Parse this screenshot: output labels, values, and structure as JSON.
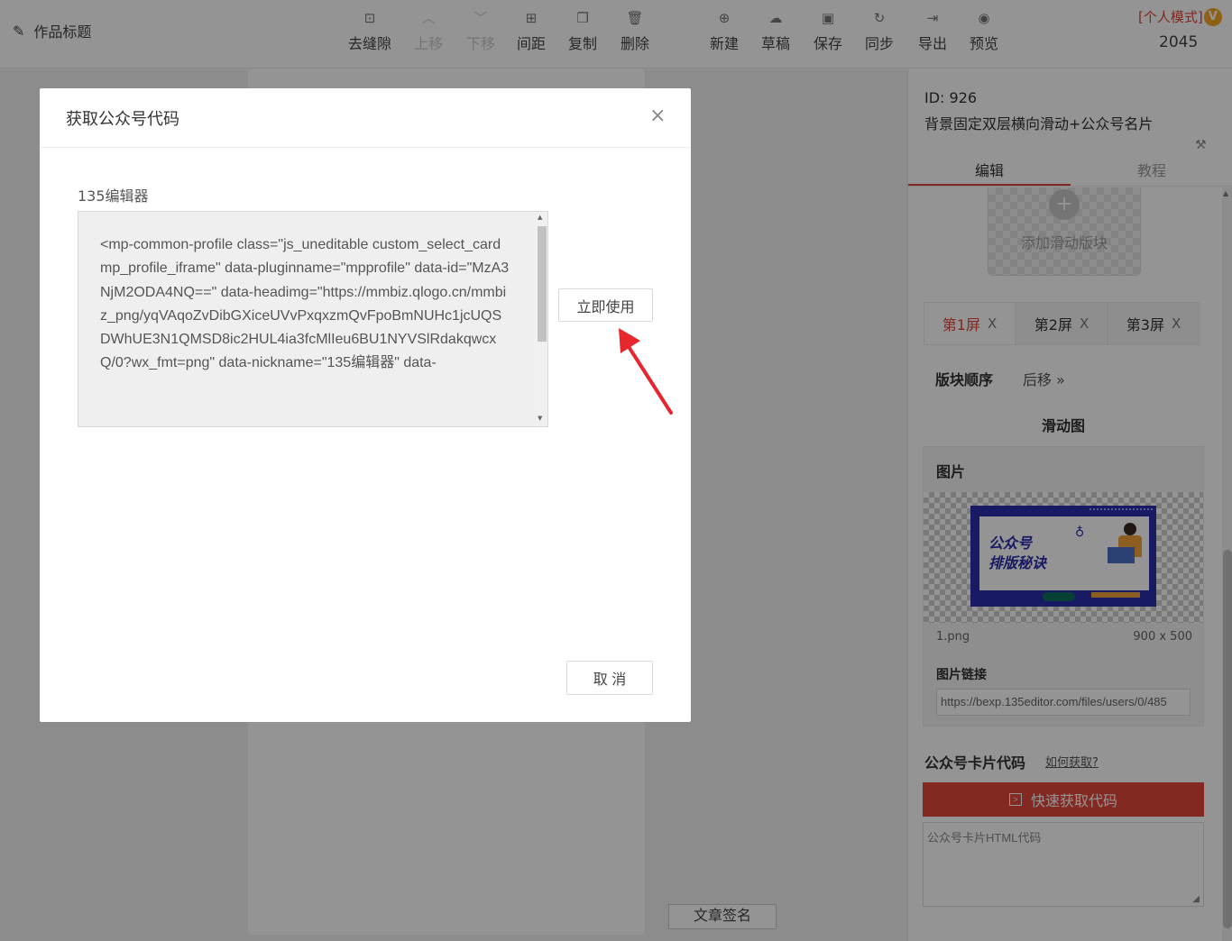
{
  "toolbar": {
    "work_title": "作品标题",
    "tools": [
      {
        "label": "去缝隙",
        "icon": "gap-icon"
      },
      {
        "label": "上移",
        "icon": "chevron-up-icon"
      },
      {
        "label": "下移",
        "icon": "chevron-down-icon"
      },
      {
        "label": "间距",
        "icon": "spacing-icon"
      },
      {
        "label": "复制",
        "icon": "copy-icon"
      },
      {
        "label": "删除",
        "icon": "trash-icon"
      },
      {
        "label": "新建",
        "icon": "new-file-icon"
      },
      {
        "label": "草稿",
        "icon": "cloud-icon"
      },
      {
        "label": "保存",
        "icon": "save-icon"
      },
      {
        "label": "同步",
        "icon": "sync-icon"
      },
      {
        "label": "导出",
        "icon": "export-icon"
      },
      {
        "label": "预览",
        "icon": "eye-icon"
      }
    ],
    "mode_label": "[个人模式]",
    "vip_badge": "V",
    "user_number": "2045"
  },
  "canvas": {
    "signature_button": "文章签名"
  },
  "panel": {
    "template_id": "ID: 926",
    "template_name": "背景固定双层横向滑动+公众号名片",
    "tabs": [
      "编辑",
      "教程"
    ],
    "add_block_label": "添加滑动版块",
    "screens": [
      {
        "label": "第1屏",
        "close": "X"
      },
      {
        "label": "第2屏",
        "close": "X"
      },
      {
        "label": "第3屏",
        "close": "X"
      }
    ],
    "order_label": "版块顺序",
    "move_back_label": "后移 »",
    "slide_title": "滑动图",
    "image": {
      "label": "图片",
      "banner_line1": "公众号",
      "banner_line2": "排版秘诀",
      "file_name": "1.png",
      "file_size": "900 x 500",
      "link_label": "图片链接",
      "link_value": "https://bexp.135editor.com/files/users/0/485"
    },
    "card_code_label": "公众号卡片代码",
    "howto_link": "如何获取?",
    "quick_button": "快速获取代码",
    "code_placeholder": "公众号卡片HTML代码"
  },
  "modal": {
    "title": "获取公众号代码",
    "close": "×",
    "editor_label": "135编辑器",
    "code": "<mp-common-profile class=\"js_uneditable custom_select_card mp_profile_iframe\" data-pluginname=\"mpprofile\" data-id=\"MzA3NjM2ODA4NQ==\" data-headimg=\"https://mmbiz.qlogo.cn/mmbiz_png/yqVAqoZvDibGXiceUVvPxqxzmQvFpoBmNUHc1jcUQSDWhUE3N1QMSD8ic2HUL4ia3fcMlIeu6BU1NYVSlRdakqwcxQ/0?wx_fmt=png\" data-nickname=\"135编辑器\" data-",
    "use_button": "立即使用",
    "cancel_button": "取 消"
  }
}
